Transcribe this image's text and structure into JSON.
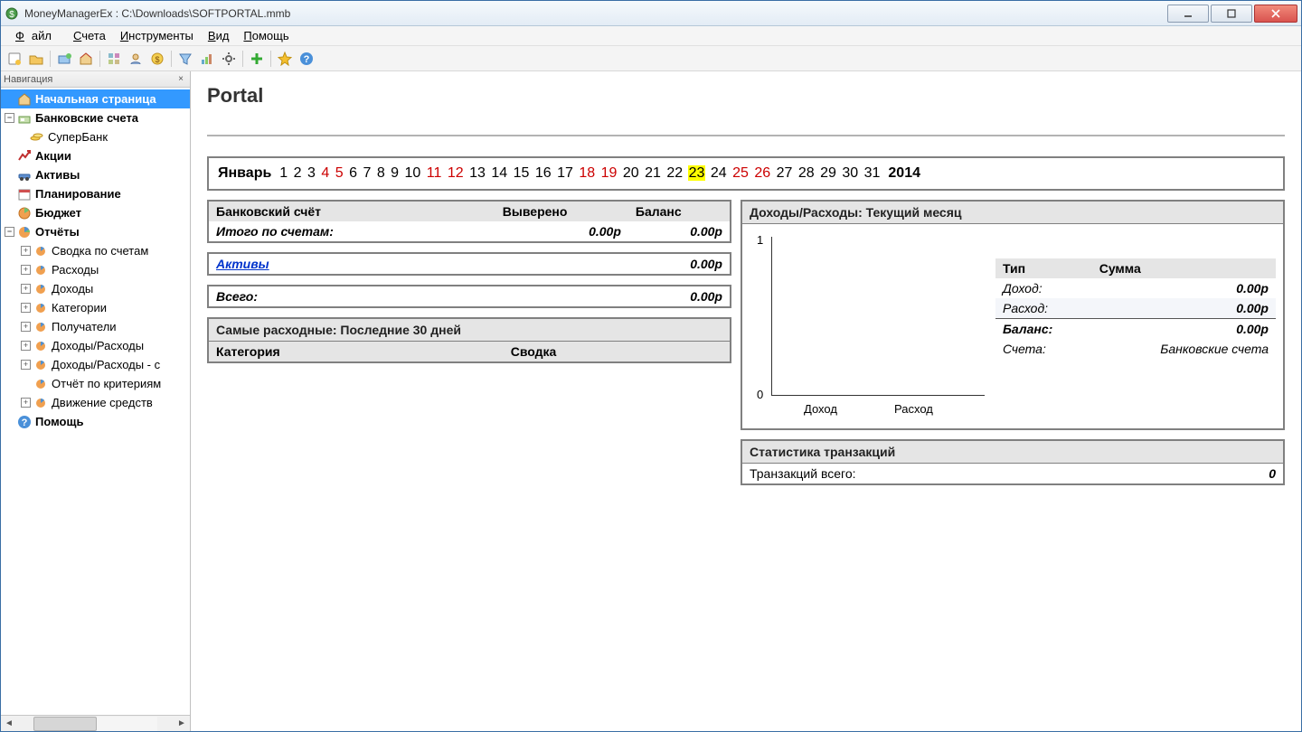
{
  "window": {
    "title": "MoneyManagerEx : C:\\Downloads\\SOFTPORTAL.mmb"
  },
  "menubar": {
    "file": "Файл",
    "accounts": "Счета",
    "tools": "Инструменты",
    "view": "Вид",
    "help": "Помощь"
  },
  "nav": {
    "header": "Навигация",
    "items": {
      "home": "Начальная страница",
      "bank_accounts": "Банковские счета",
      "superbank": "СуперБанк",
      "stocks": "Акции",
      "assets": "Активы",
      "planning": "Планирование",
      "budget": "Бюджет",
      "reports": "Отчёты",
      "summary_accounts": "Сводка по счетам",
      "expenses": "Расходы",
      "income": "Доходы",
      "categories": "Категории",
      "payees": "Получатели",
      "income_expense": "Доходы/Расходы",
      "income_expense_c": "Доходы/Расходы - с",
      "criteria_report": "Отчёт по критериям",
      "cash_flow": "Движение средств",
      "help": "Помощь"
    }
  },
  "page": {
    "title": "Portal",
    "calendar": {
      "month": "Январь",
      "year": "2014",
      "days": [
        {
          "n": "1"
        },
        {
          "n": "2"
        },
        {
          "n": "3"
        },
        {
          "n": "4",
          "red": true
        },
        {
          "n": "5",
          "red": true
        },
        {
          "n": "6"
        },
        {
          "n": "7"
        },
        {
          "n": "8"
        },
        {
          "n": "9"
        },
        {
          "n": "10"
        },
        {
          "n": "11",
          "red": true
        },
        {
          "n": "12",
          "red": true
        },
        {
          "n": "13"
        },
        {
          "n": "14"
        },
        {
          "n": "15"
        },
        {
          "n": "16"
        },
        {
          "n": "17"
        },
        {
          "n": "18",
          "red": true
        },
        {
          "n": "19",
          "red": true
        },
        {
          "n": "20"
        },
        {
          "n": "21"
        },
        {
          "n": "22"
        },
        {
          "n": "23",
          "today": true
        },
        {
          "n": "24"
        },
        {
          "n": "25",
          "red": true
        },
        {
          "n": "26",
          "red": true
        },
        {
          "n": "27"
        },
        {
          "n": "28"
        },
        {
          "n": "29"
        },
        {
          "n": "30"
        },
        {
          "n": "31"
        }
      ]
    },
    "accounts_panel": {
      "header_account": "Банковский счёт",
      "header_reconciled": "Выверено",
      "header_balance": "Баланс",
      "total_label": "Итого по счетам:",
      "total_reconciled": "0.00р",
      "total_balance": "0.00р",
      "assets_label": "Активы",
      "assets_value": "0.00р",
      "grand_label": "Всего:",
      "grand_value": "0.00р"
    },
    "top_expenses": {
      "header": "Самые расходные: Последние 30 дней",
      "col_category": "Категория",
      "col_summary": "Сводка"
    },
    "income_expense_panel": {
      "header": "Доходы/Расходы: Текущий месяц",
      "col_type": "Тип",
      "col_amount": "Сумма",
      "row_income_label": "Доход:",
      "row_income_value": "0.00р",
      "row_expense_label": "Расход:",
      "row_expense_value": "0.00р",
      "row_balance_label": "Баланс:",
      "row_balance_value": "0.00р",
      "accounts_label": "Счета:",
      "accounts_value": "Банковские счета"
    },
    "chart": {
      "y_max": "1",
      "y_min": "0",
      "x1": "Доход",
      "x2": "Расход"
    },
    "stats_panel": {
      "header": "Статистика транзакций",
      "total_label": "Транзакций всего:",
      "total_value": "0"
    }
  },
  "chart_data": {
    "type": "bar",
    "categories": [
      "Доход",
      "Расход"
    ],
    "values": [
      0,
      0
    ],
    "title": "Доходы/Расходы: Текущий месяц",
    "xlabel": "",
    "ylabel": "",
    "ylim": [
      0,
      1
    ]
  }
}
